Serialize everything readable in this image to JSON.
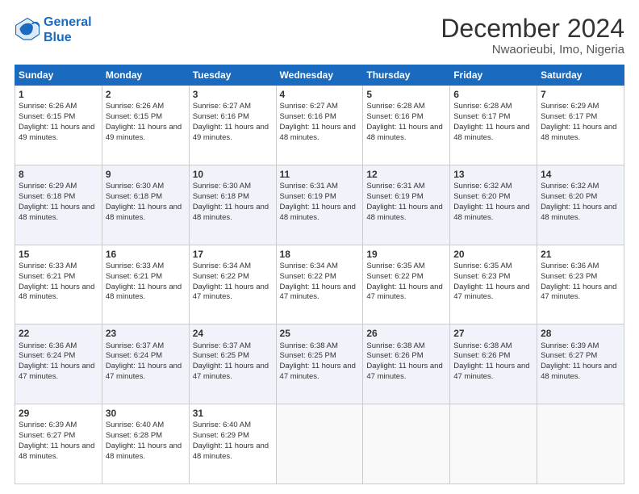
{
  "header": {
    "logo_line1": "General",
    "logo_line2": "Blue",
    "title": "December 2024",
    "subtitle": "Nwaorieubi, Imo, Nigeria"
  },
  "calendar": {
    "days": [
      "Sunday",
      "Monday",
      "Tuesday",
      "Wednesday",
      "Thursday",
      "Friday",
      "Saturday"
    ],
    "weeks": [
      [
        {
          "day": "1",
          "info": "Sunrise: 6:26 AM\nSunset: 6:15 PM\nDaylight: 11 hours and 49 minutes."
        },
        {
          "day": "2",
          "info": "Sunrise: 6:26 AM\nSunset: 6:15 PM\nDaylight: 11 hours and 49 minutes."
        },
        {
          "day": "3",
          "info": "Sunrise: 6:27 AM\nSunset: 6:16 PM\nDaylight: 11 hours and 49 minutes."
        },
        {
          "day": "4",
          "info": "Sunrise: 6:27 AM\nSunset: 6:16 PM\nDaylight: 11 hours and 48 minutes."
        },
        {
          "day": "5",
          "info": "Sunrise: 6:28 AM\nSunset: 6:16 PM\nDaylight: 11 hours and 48 minutes."
        },
        {
          "day": "6",
          "info": "Sunrise: 6:28 AM\nSunset: 6:17 PM\nDaylight: 11 hours and 48 minutes."
        },
        {
          "day": "7",
          "info": "Sunrise: 6:29 AM\nSunset: 6:17 PM\nDaylight: 11 hours and 48 minutes."
        }
      ],
      [
        {
          "day": "8",
          "info": "Sunrise: 6:29 AM\nSunset: 6:18 PM\nDaylight: 11 hours and 48 minutes."
        },
        {
          "day": "9",
          "info": "Sunrise: 6:30 AM\nSunset: 6:18 PM\nDaylight: 11 hours and 48 minutes."
        },
        {
          "day": "10",
          "info": "Sunrise: 6:30 AM\nSunset: 6:18 PM\nDaylight: 11 hours and 48 minutes."
        },
        {
          "day": "11",
          "info": "Sunrise: 6:31 AM\nSunset: 6:19 PM\nDaylight: 11 hours and 48 minutes."
        },
        {
          "day": "12",
          "info": "Sunrise: 6:31 AM\nSunset: 6:19 PM\nDaylight: 11 hours and 48 minutes."
        },
        {
          "day": "13",
          "info": "Sunrise: 6:32 AM\nSunset: 6:20 PM\nDaylight: 11 hours and 48 minutes."
        },
        {
          "day": "14",
          "info": "Sunrise: 6:32 AM\nSunset: 6:20 PM\nDaylight: 11 hours and 48 minutes."
        }
      ],
      [
        {
          "day": "15",
          "info": "Sunrise: 6:33 AM\nSunset: 6:21 PM\nDaylight: 11 hours and 48 minutes."
        },
        {
          "day": "16",
          "info": "Sunrise: 6:33 AM\nSunset: 6:21 PM\nDaylight: 11 hours and 48 minutes."
        },
        {
          "day": "17",
          "info": "Sunrise: 6:34 AM\nSunset: 6:22 PM\nDaylight: 11 hours and 47 minutes."
        },
        {
          "day": "18",
          "info": "Sunrise: 6:34 AM\nSunset: 6:22 PM\nDaylight: 11 hours and 47 minutes."
        },
        {
          "day": "19",
          "info": "Sunrise: 6:35 AM\nSunset: 6:22 PM\nDaylight: 11 hours and 47 minutes."
        },
        {
          "day": "20",
          "info": "Sunrise: 6:35 AM\nSunset: 6:23 PM\nDaylight: 11 hours and 47 minutes."
        },
        {
          "day": "21",
          "info": "Sunrise: 6:36 AM\nSunset: 6:23 PM\nDaylight: 11 hours and 47 minutes."
        }
      ],
      [
        {
          "day": "22",
          "info": "Sunrise: 6:36 AM\nSunset: 6:24 PM\nDaylight: 11 hours and 47 minutes."
        },
        {
          "day": "23",
          "info": "Sunrise: 6:37 AM\nSunset: 6:24 PM\nDaylight: 11 hours and 47 minutes."
        },
        {
          "day": "24",
          "info": "Sunrise: 6:37 AM\nSunset: 6:25 PM\nDaylight: 11 hours and 47 minutes."
        },
        {
          "day": "25",
          "info": "Sunrise: 6:38 AM\nSunset: 6:25 PM\nDaylight: 11 hours and 47 minutes."
        },
        {
          "day": "26",
          "info": "Sunrise: 6:38 AM\nSunset: 6:26 PM\nDaylight: 11 hours and 47 minutes."
        },
        {
          "day": "27",
          "info": "Sunrise: 6:38 AM\nSunset: 6:26 PM\nDaylight: 11 hours and 47 minutes."
        },
        {
          "day": "28",
          "info": "Sunrise: 6:39 AM\nSunset: 6:27 PM\nDaylight: 11 hours and 48 minutes."
        }
      ],
      [
        {
          "day": "29",
          "info": "Sunrise: 6:39 AM\nSunset: 6:27 PM\nDaylight: 11 hours and 48 minutes."
        },
        {
          "day": "30",
          "info": "Sunrise: 6:40 AM\nSunset: 6:28 PM\nDaylight: 11 hours and 48 minutes."
        },
        {
          "day": "31",
          "info": "Sunrise: 6:40 AM\nSunset: 6:29 PM\nDaylight: 11 hours and 48 minutes."
        },
        null,
        null,
        null,
        null
      ]
    ]
  }
}
